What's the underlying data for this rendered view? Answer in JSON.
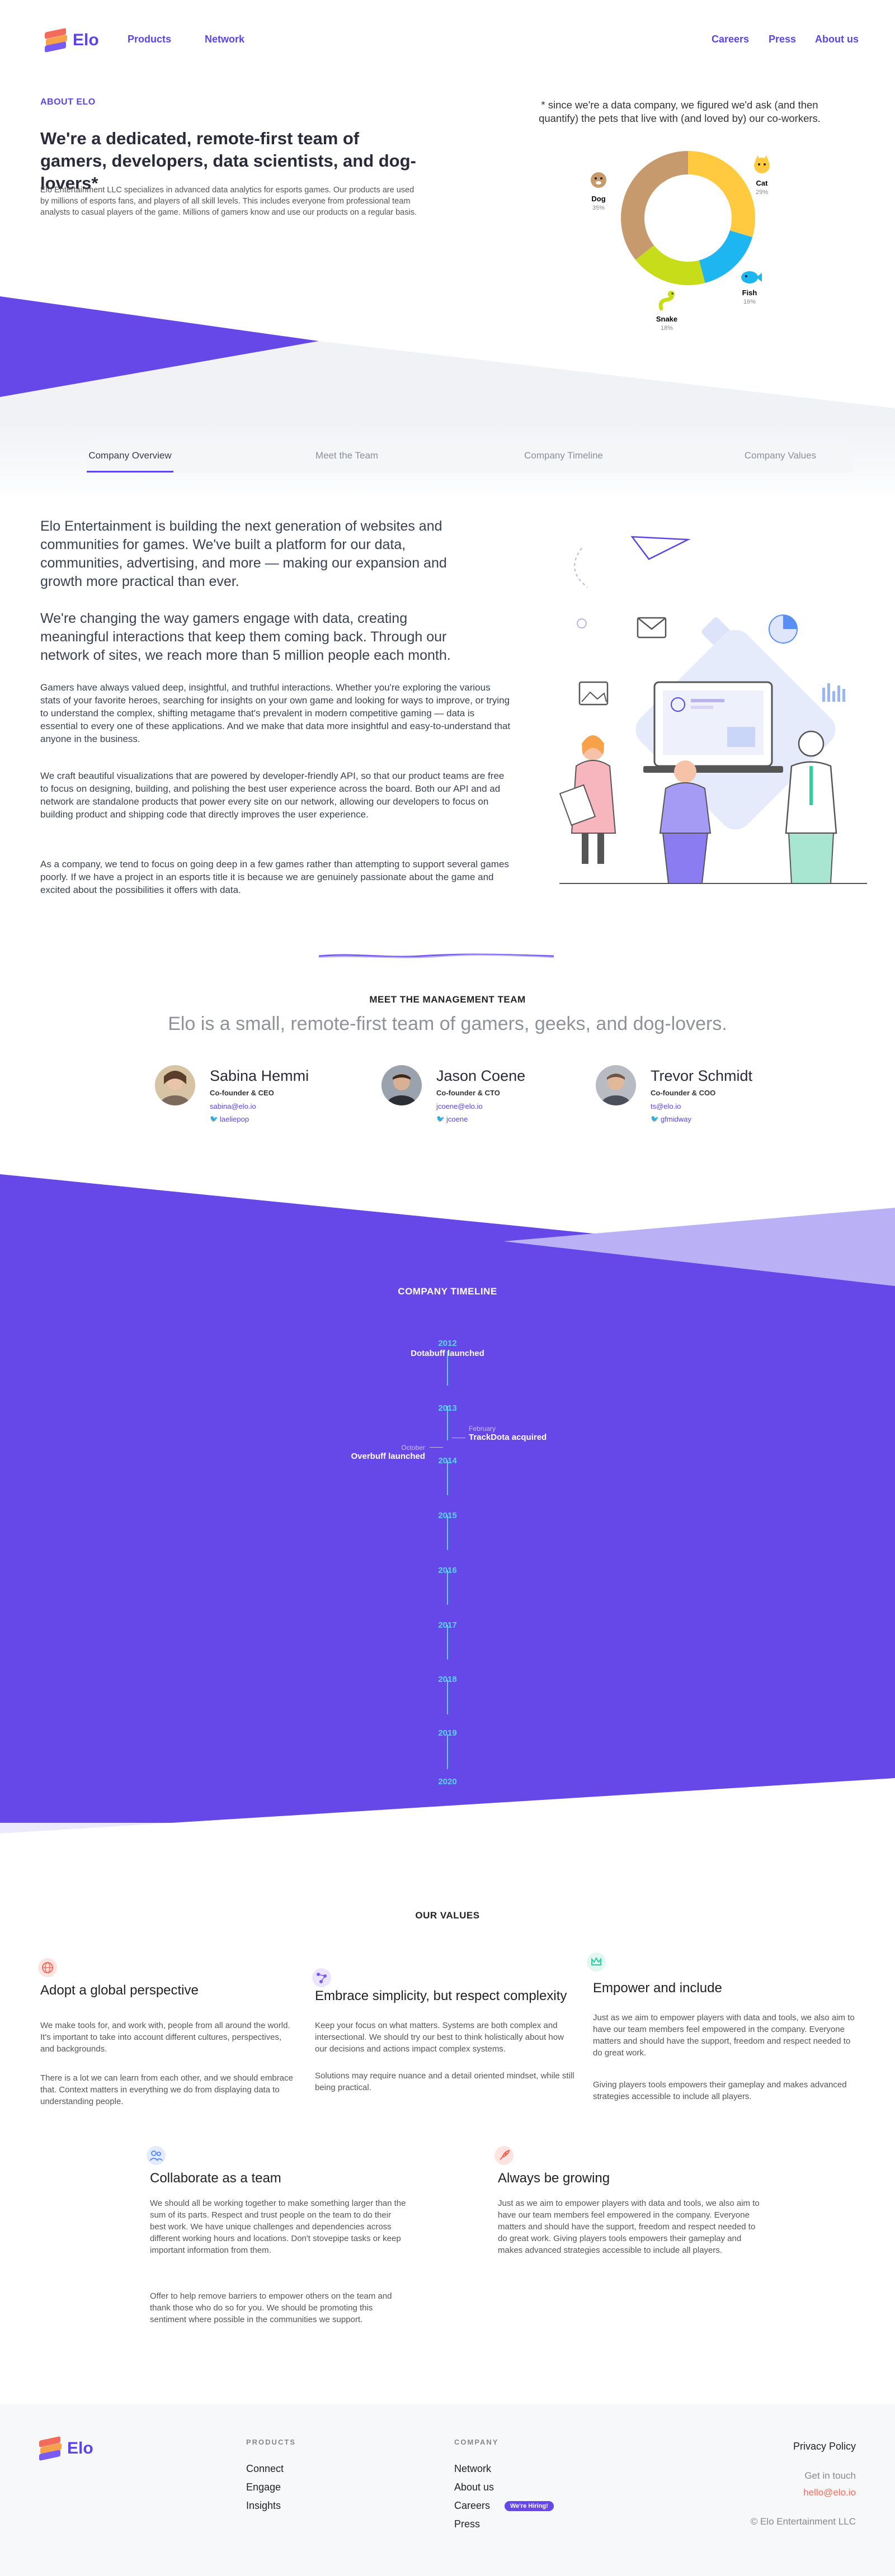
{
  "header": {
    "logo_text": "Elo",
    "nav_left": [
      "Products",
      "Network"
    ],
    "nav_right": [
      "Careers",
      "Press",
      "About us"
    ]
  },
  "about": {
    "eyebrow": "ABOUT ELO",
    "heading": "We're a dedicated, remote-first team of gamers, developers, data scientists, and dog-lovers*",
    "paragraph": "Elo Entertainment LLC specializes in advanced data analytics for esports games. Our products are used by millions of esports fans, and players of all skill levels. This includes everyone from professional team analysts to casual players of the game. Millions of gamers know and use our products on a regular basis.",
    "chart_caption": "* since we're a data company, we figured we'd ask (and then quantify) the pets that live with (and loved by) our co-workers."
  },
  "chart_data": {
    "type": "pie",
    "slices": [
      {
        "label": "Cat",
        "value": 29,
        "display": "29%",
        "color": "#ffc940"
      },
      {
        "label": "Fish",
        "value": 16,
        "display": "16%",
        "color": "#1eb6f0"
      },
      {
        "label": "Snake",
        "value": 18,
        "display": "18%",
        "color": "#c7dd1a"
      },
      {
        "label": "Dog",
        "value": 35,
        "display": "35%",
        "color": "#c69a6d"
      }
    ]
  },
  "tabs": [
    "Company Overview",
    "Meet the Team",
    "Company Timeline",
    "Company Values"
  ],
  "overview": {
    "lead1": "Elo Entertainment is building the next generation of websites and communities for games. We've built a platform for our data, communities, advertising, and more — making our expansion and growth more practical than ever.",
    "lead2": "We're changing the way gamers engage with data, creating meaningful interactions that keep them coming back. Through our network of sites, we reach more than 5 million people each month.",
    "p1": "Gamers have always valued deep, insightful, and truthful interactions. Whether you're exploring the various stats of your favorite heroes, searching for insights on your own game and looking for ways to improve, or trying to understand the complex, shifting metagame that's prevalent in modern competitive gaming — data is essential to every one of these applications. And we make that data more insightful and easy-to-understand that anyone in the business.",
    "p2": "We craft beautiful visualizations that are powered by developer-friendly API, so that our product teams are free to focus on designing, building, and polishing the best user experience across the board. Both our API and ad network are standalone products that power every site on our network, allowing our developers to focus on building product and shipping code that directly improves the user experience.",
    "p3": "As a company, we tend to focus on going deep in a few games rather than attempting to support several games poorly. If we have a project in an esports title it is because we are genuinely passionate about the game and excited about the possibilities it offers with data."
  },
  "team": {
    "title": "MEET THE MANAGEMENT TEAM",
    "subtitle": "Elo is a small, remote-first team of gamers, geeks, and dog-lovers.",
    "members": [
      {
        "name": "Sabina Hemmi",
        "role": "Co-founder & CEO",
        "email": "sabina@elo.io",
        "twitter": "laeliepop"
      },
      {
        "name": "Jason Coene",
        "role": "Co-founder & CTO",
        "email": "jcoene@elo.io",
        "twitter": "jcoene"
      },
      {
        "name": "Trevor Schmidt",
        "role": "Co-founder & COO",
        "email": "ts@elo.io",
        "twitter": "gfmidway"
      }
    ]
  },
  "timeline": {
    "title": "COMPANY TIMELINE",
    "years": [
      "2012",
      "2013",
      "2014",
      "2015",
      "2016",
      "2017",
      "2018",
      "2019",
      "2020"
    ],
    "events": [
      {
        "month": "",
        "text": "Dotabuff launched"
      },
      {
        "month": "February",
        "text": "TrackDota acquired"
      },
      {
        "month": "October",
        "text": "Overbuff launched"
      }
    ]
  },
  "values": {
    "title": "OUR VALUES",
    "items": [
      {
        "title": "Adopt a global perspective",
        "icon": "globe-icon",
        "color": "#f26b5b",
        "p1": "We make tools for, and work with, people from all around the world. It's important to take into account different cultures, perspectives, and backgrounds.",
        "p2": "There is a lot we can learn from each other, and we should embrace that. Context matters in everything we do from displaying data to understanding people."
      },
      {
        "title": "Embrace simplicity, but respect complexity",
        "icon": "nodes-icon",
        "color": "#7a5af5",
        "p1": "Keep your focus on what matters. Systems are both complex and intersectional. We should try our best to think holistically about how our decisions and actions impact complex systems.",
        "p2": "Solutions may require nuance and a detail oriented mindset, while still being practical."
      },
      {
        "title": "Empower and include",
        "icon": "crown-icon",
        "color": "#2fcf9f",
        "p1": "Just as we aim to empower players with data and tools, we also aim to have our team members feel empowered in the company. Everyone matters and should have the support, freedom and respect needed to do great work.",
        "p2": "Giving players tools empowers their gameplay and makes advanced strategies accessible to include all players."
      },
      {
        "title": "Collaborate as a team",
        "icon": "people-icon",
        "color": "#5b8ef5",
        "p1": "We should all be working together to make something larger than the sum of its parts. Respect and trust people on the team to do their best work. We have unique challenges and dependencies across different working hours and locations. Don't stovepipe tasks or keep important information from them.",
        "p2": "Offer to help remove barriers to empower others on the team and thank those who do so for you. We should be promoting this sentiment where possible in the communities we support."
      },
      {
        "title": "Always be growing",
        "icon": "rocket-icon",
        "color": "#f5604f",
        "p1": "Just as we aim to empower players with data and tools, we also aim to have our team members feel empowered in the company. Everyone matters and should have the support, freedom and respect needed to do great work. Giving players tools empowers their gameplay and makes advanced strategies accessible to include all players.",
        "p2": ""
      }
    ]
  },
  "footer": {
    "logo_text": "Elo",
    "products_head": "PRODUCTS",
    "products": [
      "Connect",
      "Engage",
      "Insights"
    ],
    "company_head": "COMPANY",
    "company": [
      "Network",
      "About us",
      "Careers",
      "Press"
    ],
    "hiring_badge": "We're Hiring!",
    "privacy": "Privacy Policy",
    "get_in_touch": "Get in touch",
    "email": "hello@elo.io",
    "copyright": "© Elo Entertainment LLC"
  }
}
